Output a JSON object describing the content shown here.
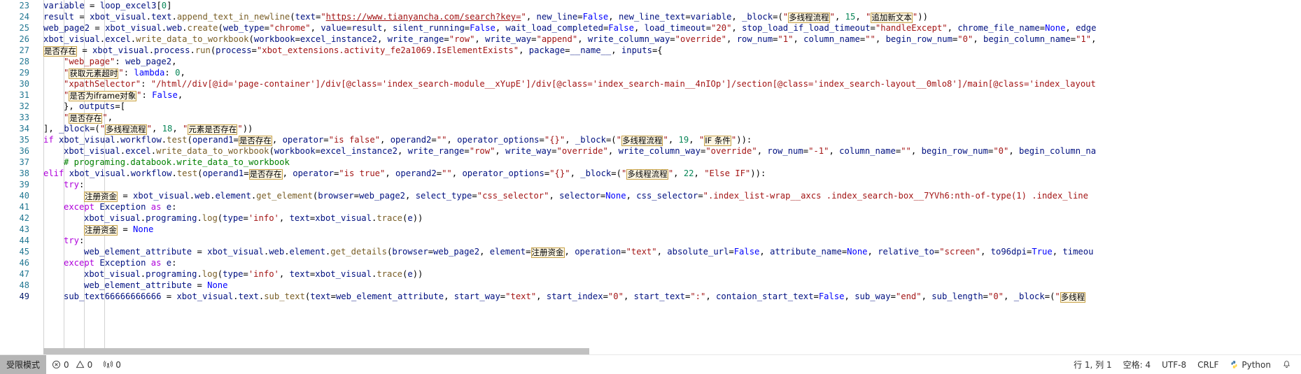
{
  "editor": {
    "language": "Python",
    "first_line_number": 23,
    "lines": [
      {
        "n": 23,
        "indent": 2,
        "text": "variable = loop_excel3[0]"
      },
      {
        "n": 24,
        "indent": 2,
        "text": "result = xbot_visual.text.append_text_in_newline(text=\"https://www.tianyancha.com/search?key=\", new_line=False, new_line_text=variable, _block=(\"多线程流程\", 15, \"追加新文本\"))"
      },
      {
        "n": 25,
        "indent": 2,
        "text": "web_page2 = xbot_visual.web.create(web_type=\"chrome\", value=result, silent_running=False, wait_load_completed=False, load_timeout=\"20\", stop_load_if_load_timeout=\"handleExcept\", chrome_file_name=None, edge"
      },
      {
        "n": 26,
        "indent": 2,
        "text": "xbot_visual.excel.write_data_to_workbook(workbook=excel_instance2, write_range=\"row\", write_way=\"append\", write_column_way=\"override\", row_num=\"1\", column_name=\"\", begin_row_num=\"0\", begin_column_name=\"1\","
      },
      {
        "n": 27,
        "indent": 2,
        "text": "是否存在 = xbot_visual.process.run(process=\"xbot_extensions.activity_fe2a1069.IsElementExists\", package=__name__, inputs={"
      },
      {
        "n": 28,
        "indent": 3,
        "text": "\"web_page\": web_page2,"
      },
      {
        "n": 29,
        "indent": 3,
        "text": "\"获取元素超时\": lambda: 0,"
      },
      {
        "n": 30,
        "indent": 3,
        "text": "\"xpathSelector\": \"/html//div[@id='page-container']/div[@class='index_search-module__xYupE']/div[@class='index_search-main__4nIOp']/section[@class='index_search-layout__0mlo8']/main[@class='index_layout"
      },
      {
        "n": 31,
        "indent": 3,
        "text": "\"是否为iframe对象\": False,"
      },
      {
        "n": 32,
        "indent": 3,
        "text": "}, outputs=["
      },
      {
        "n": 33,
        "indent": 3,
        "text": "\"是否存在\","
      },
      {
        "n": 34,
        "indent": 2,
        "text": "], _block=(\"多线程流程\", 18, \"元素是否存在\"))"
      },
      {
        "n": 35,
        "indent": 2,
        "text": "if xbot_visual.workflow.test(operand1=是否存在, operator=\"is false\", operand2=\"\", operator_options=\"{}\", _block=(\"多线程流程\", 19, \"IF 条件\")):"
      },
      {
        "n": 36,
        "indent": 3,
        "text": "xbot_visual.excel.write_data_to_workbook(workbook=excel_instance2, write_range=\"row\", write_way=\"override\", write_column_way=\"override\", row_num=\"-1\", column_name=\"\", begin_row_num=\"0\", begin_column_na"
      },
      {
        "n": 37,
        "indent": 3,
        "text": "# programing.databook.write_data_to_workbook"
      },
      {
        "n": 38,
        "indent": 2,
        "text": "elif xbot_visual.workflow.test(operand1=是否存在, operator=\"is true\", operand2=\"\", operator_options=\"{}\", _block=(\"多线程流程\", 22, \"Else IF\")):"
      },
      {
        "n": 39,
        "indent": 3,
        "text": "try:"
      },
      {
        "n": 40,
        "indent": 4,
        "text": "注册资金 = xbot_visual.web.element.get_element(browser=web_page2, select_type=\"css_selector\", selector=None, css_selector=\".index_list-wrap__axcs .index_search-box__7YVh6:nth-of-type(1) .index_line"
      },
      {
        "n": 41,
        "indent": 3,
        "text": "except Exception as e:"
      },
      {
        "n": 42,
        "indent": 4,
        "text": "xbot_visual.programing.log(type='info', text=xbot_visual.trace(e))"
      },
      {
        "n": 43,
        "indent": 4,
        "text": "注册资金 = None"
      },
      {
        "n": 44,
        "indent": 3,
        "text": "try:"
      },
      {
        "n": 45,
        "indent": 4,
        "text": "web_element_attribute = xbot_visual.web.element.get_details(browser=web_page2, element=注册资金, operation=\"text\", absolute_url=False, attribute_name=None, relative_to=\"screen\", to96dpi=True, timeou"
      },
      {
        "n": 46,
        "indent": 3,
        "text": "except Exception as e:"
      },
      {
        "n": 47,
        "indent": 4,
        "text": "xbot_visual.programing.log(type='info', text=xbot_visual.trace(e))"
      },
      {
        "n": 48,
        "indent": 4,
        "text": "web_element_attribute = None"
      },
      {
        "n": 49,
        "indent": 3,
        "text": "sub_text66666666666 = xbot_visual.text.sub_text(text=web_element_attribute, start_way=\"text\", start_index=\"0\", start_text=\":\", contaion_start_text=False, sub_way=\"end\", sub_length=\"0\", _block=(\"多线程"
      }
    ],
    "tokens": {
      "exists": "是否存在",
      "get_element_timeout": "获取元素超时",
      "is_iframe": "是否为iframe对象",
      "multithread_flow": "多线程流程",
      "append_new_text": "追加新文本",
      "element_exists": "元素是否存在",
      "if_condition": "IF 条件",
      "else_if": "Else IF",
      "registered_capital": "注册资金"
    }
  },
  "statusbar": {
    "restricted_mode": "受限模式",
    "errors": "0",
    "warnings": "0",
    "ports": "0",
    "cursor": "行 1, 列 1",
    "indentation": "空格: 4",
    "encoding": "UTF-8",
    "eol": "CRLF",
    "language": "Python",
    "icons": {
      "error": "error-circle-icon",
      "warning": "warning-triangle-icon",
      "ports": "radio-tower-icon",
      "bell": "bell-icon"
    }
  },
  "colors": {
    "line_number": "#237893",
    "keyword": "#af00db",
    "string": "#a31515",
    "number": "#098658",
    "comment": "#008000",
    "function": "#795e26",
    "identifier": "#001080",
    "token_border": "#c8a34a",
    "token_bg": "#fdf6e3",
    "selection": "#add6ff",
    "restricted_bg": "#b5b5b5"
  }
}
